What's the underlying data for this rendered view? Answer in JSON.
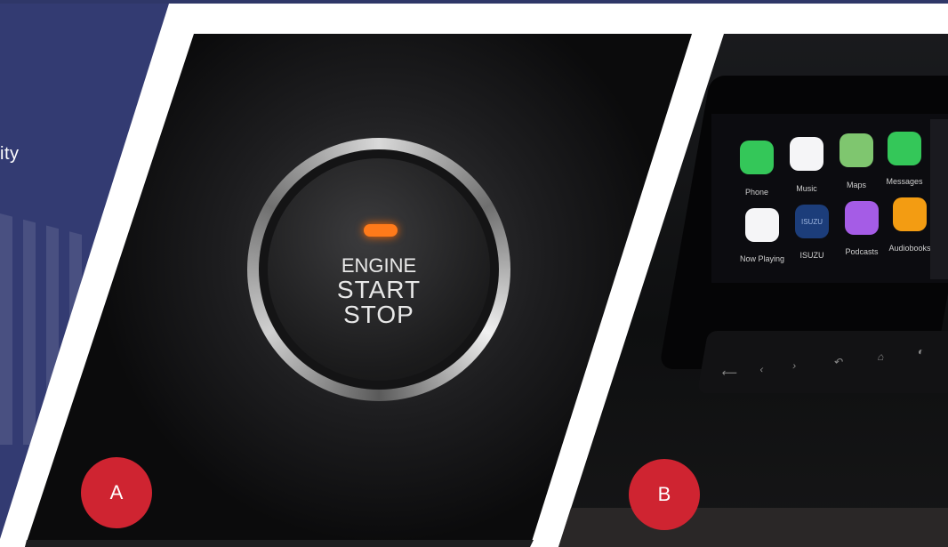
{
  "left_panel": {
    "text": "ity"
  },
  "panel_a": {
    "button": {
      "line1": "ENGINE",
      "line2": "START",
      "line3": "STOP"
    },
    "badge": "A"
  },
  "panel_b": {
    "apps": [
      {
        "label": "Phone",
        "icon": "phone-icon",
        "color": "#34c759"
      },
      {
        "label": "Music",
        "icon": "music-icon",
        "color": "#f5f5f7"
      },
      {
        "label": "Maps",
        "icon": "maps-icon",
        "color": "#7fc66f"
      },
      {
        "label": "Messages",
        "icon": "messages-icon",
        "color": "#34c759"
      },
      {
        "label": "Now Playing",
        "icon": "now-playing-icon",
        "color": "#f5f5f7"
      },
      {
        "label": "ISUZU",
        "icon": "isuzu-icon",
        "color": "#1c3d7a"
      },
      {
        "label": "Podcasts",
        "icon": "podcasts-icon",
        "color": "#a55ce6"
      },
      {
        "label": "Audiobooks",
        "icon": "audiobooks-icon",
        "color": "#f39c12"
      }
    ],
    "app_tile_text": "ISUZU",
    "controls": [
      "⟵",
      "‹",
      "›",
      "↶",
      "⌂",
      "◐"
    ],
    "badge": "B"
  },
  "colors": {
    "navy": "#333b72",
    "badge_red": "#cf2431",
    "led_orange": "#ff7a1a"
  }
}
